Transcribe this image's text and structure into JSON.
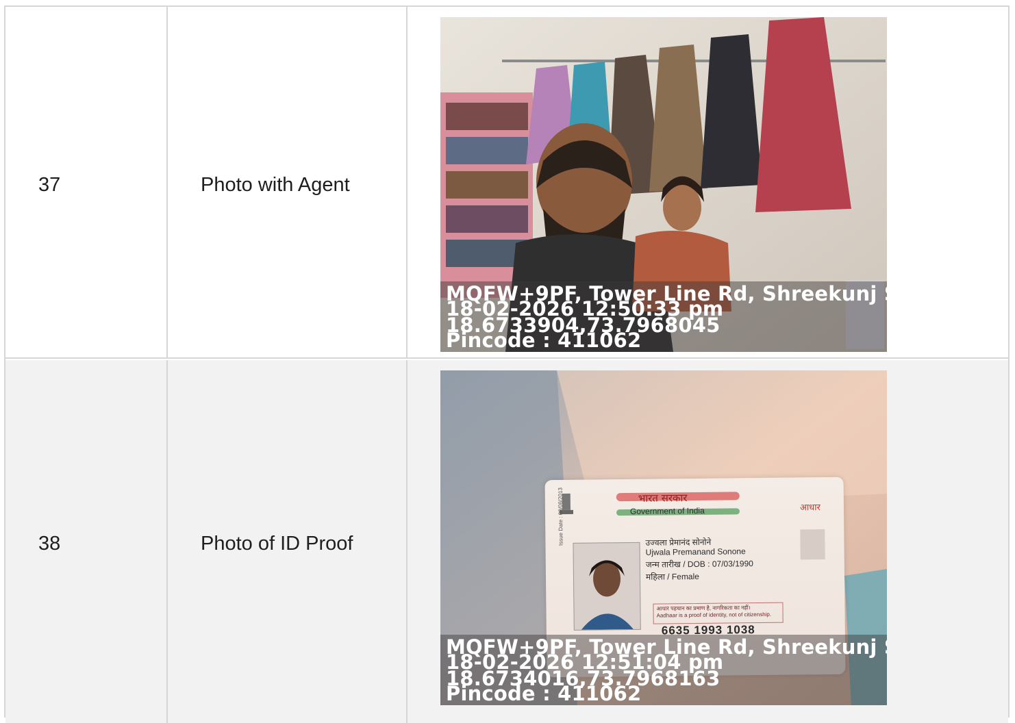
{
  "rows": [
    {
      "number": "37",
      "title": "Photo with Agent",
      "stamp": {
        "address": "MQFW+9PF, Tower Line Rd, Shreekunj S",
        "datetime": "18-02-2026 12:50:33 pm",
        "coords": "18.6733904,73.7968045",
        "pincode": "Pincode : 411062"
      }
    },
    {
      "number": "38",
      "title": "Photo of ID Proof",
      "stamp": {
        "address": "MQFW+9PF, Tower Line Rd, Shreekunj S",
        "datetime": "18-02-2026 12:51:04 pm",
        "coords": "18.6734016,73.7968163",
        "pincode": "Pincode : 411062"
      },
      "card": {
        "heading_hi": "भारत सरकार",
        "heading_en": "Government of India",
        "logo": "आधार",
        "name_hi": "उज्वला प्रेमानंद सोनोने",
        "name_en": "Ujwala Premanand Sonone",
        "dob": "जन्म तारीख / DOB : 07/03/1990",
        "gender": "महिला / Female",
        "issue_date": "Issue Date : 08/08/2013",
        "note_hi": "आधार पहचान का प्रमाण है, नागरिकता का नहीं।",
        "note_en": "Aadhaar is a proof of identity, not of citizenship.",
        "number": "6635 1993 1038"
      }
    }
  ]
}
